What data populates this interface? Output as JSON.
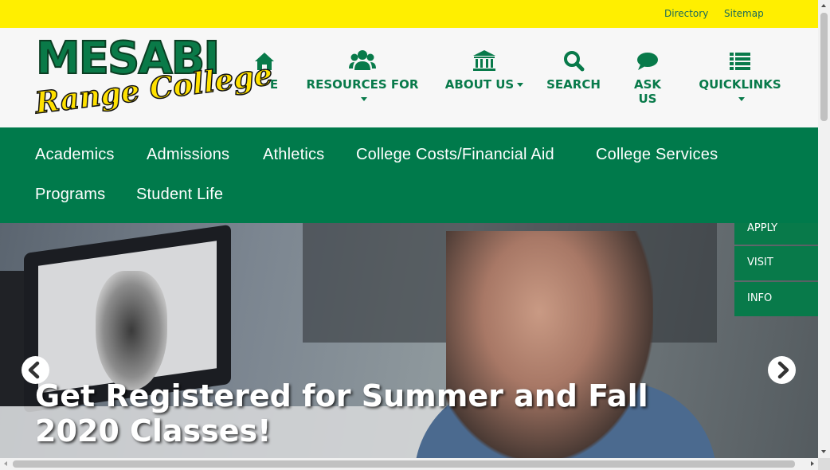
{
  "utility": {
    "directory": "Directory",
    "sitemap": "Sitemap"
  },
  "logo": {
    "line1": "MESABI",
    "line2": "Range College"
  },
  "top_nav": {
    "home_partial": "E",
    "resources": "RESOURCES FOR",
    "about": "ABOUT US",
    "search": "SEARCH",
    "ask": "ASK US",
    "quicklinks": "QUICKLINKS"
  },
  "main_nav": {
    "academics": "Academics",
    "admissions": "Admissions",
    "athletics": "Athletics",
    "costs": "College Costs/Financial Aid",
    "services": "College Services",
    "programs": "Programs",
    "student_life": "Student Life"
  },
  "hero": {
    "title": "Get Registered for Summer and Fall 2020 Classes!"
  },
  "side_tabs": {
    "apply": "APPLY",
    "visit": "VISIT",
    "info": "INFO"
  },
  "colors": {
    "brand_green": "#007a4b",
    "brand_yellow": "#ffef00"
  },
  "icons": [
    "home-icon",
    "users-icon",
    "institution-icon",
    "search-icon",
    "comment-icon",
    "list-icon",
    "chevron-left-icon",
    "chevron-right-icon"
  ]
}
